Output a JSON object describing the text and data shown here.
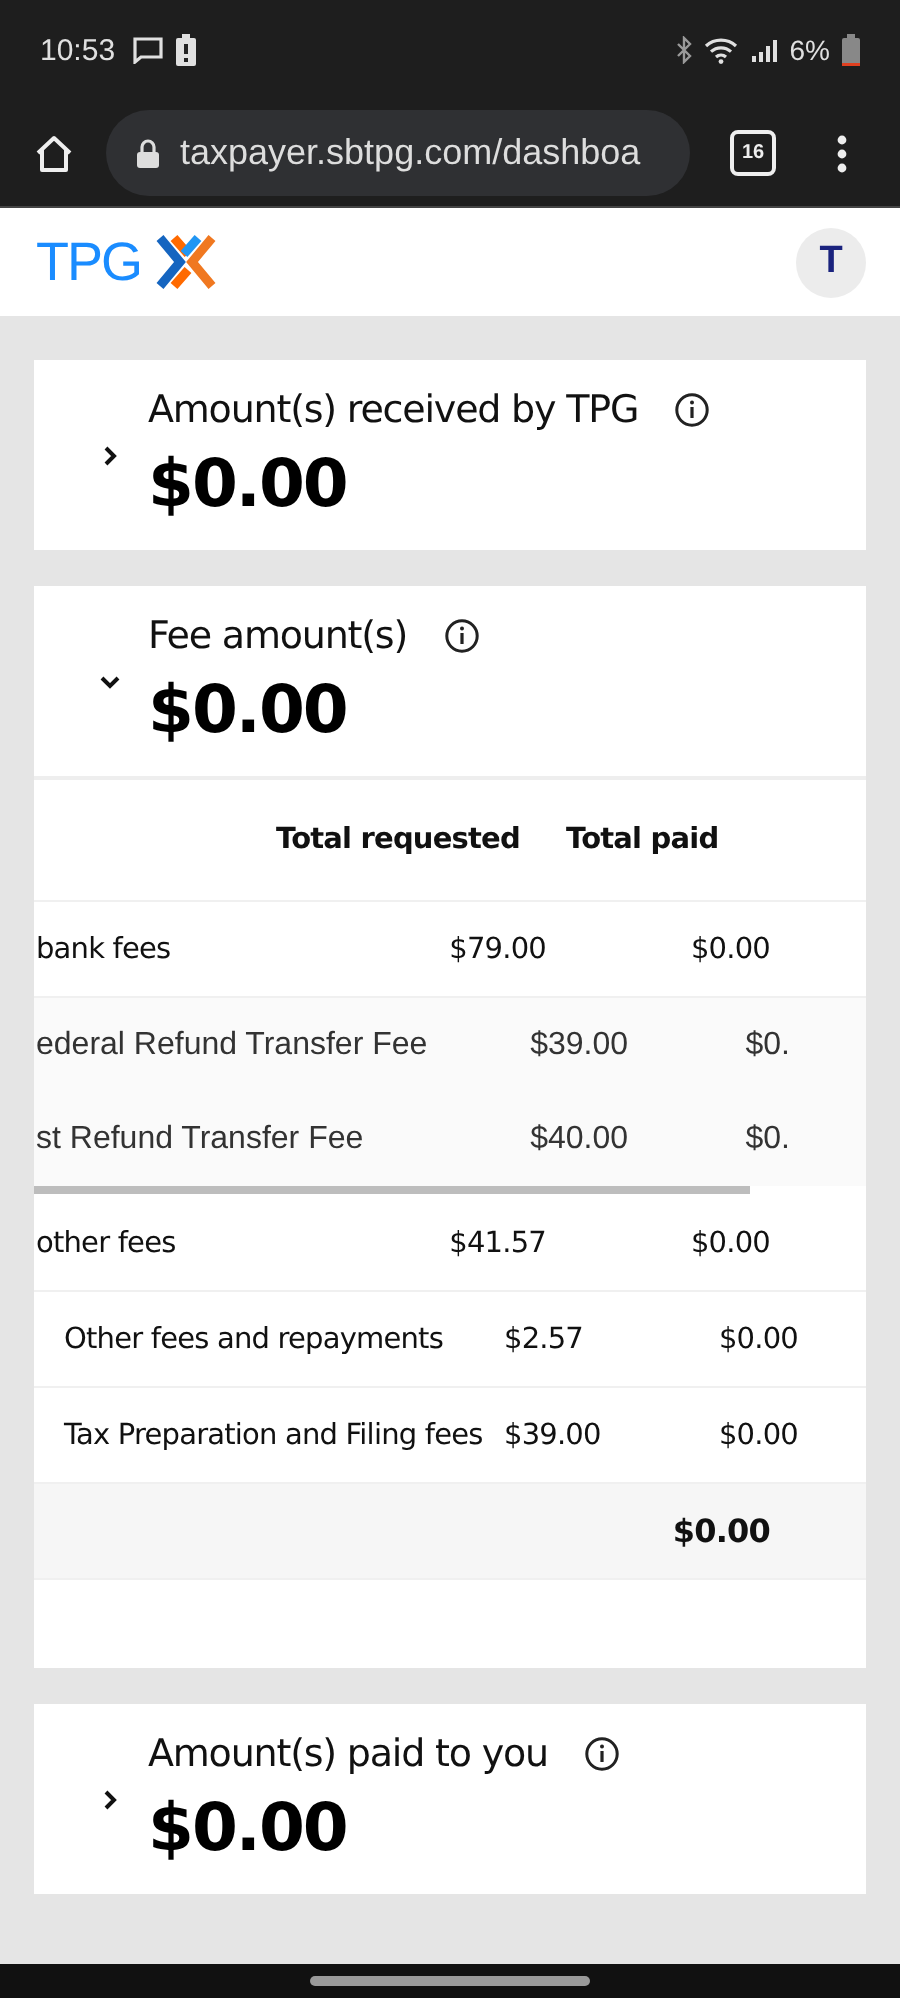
{
  "status_bar": {
    "time": "10:53",
    "battery_percent": "6%"
  },
  "browser": {
    "url": "taxpayer.sbtpg.com/dashboa",
    "tab_count": "16"
  },
  "header": {
    "logo": "TPG",
    "avatar": "T"
  },
  "cards": [
    {
      "title": "Amount(s) received by TPG",
      "amount": "$0.00",
      "expanded": false
    },
    {
      "title": "Fee amount(s)",
      "amount": "$0.00",
      "expanded": true,
      "table": {
        "columns": [
          "Total requested",
          "Total paid"
        ],
        "rows": [
          {
            "kind": "group",
            "label": "bank fees",
            "requested": "$79.00",
            "paid": "$0.00"
          },
          {
            "kind": "scrolled",
            "label": "ederal Refund Transfer Fee",
            "requested": "$39.00",
            "paid": "$0."
          },
          {
            "kind": "scrolled",
            "label": "st Refund Transfer Fee",
            "requested": "$40.00",
            "paid": "$0."
          },
          {
            "kind": "group",
            "label": "other fees",
            "requested": "$41.57",
            "paid": "$0.00"
          },
          {
            "kind": "sub",
            "label": "Other fees and repayments",
            "requested": "$2.57",
            "paid": "$0.00"
          },
          {
            "kind": "sub",
            "label": "Tax Preparation and Filing fees",
            "requested": "$39.00",
            "paid": "$0.00"
          },
          {
            "kind": "total",
            "paid": "$0.00"
          }
        ]
      }
    },
    {
      "title": "Amount(s) paid to you",
      "amount": "$0.00",
      "expanded": false
    }
  ]
}
